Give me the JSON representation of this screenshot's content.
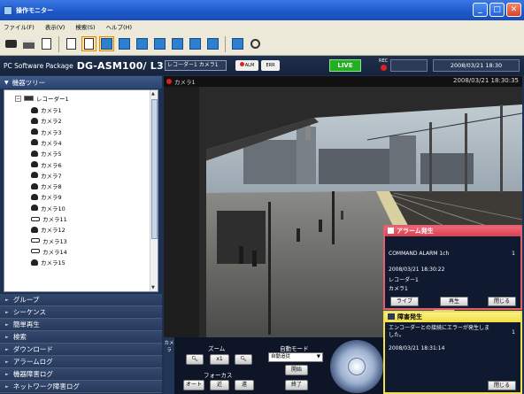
{
  "window": {
    "title": "操作モニター",
    "min": "_",
    "max": "□",
    "close": "✕"
  },
  "menu": [
    "ファイル(F)",
    "表示(V)",
    "検索(S)",
    "ヘルプ(H)"
  ],
  "header": {
    "pkg_label": "PC Software Package",
    "model": "DG-ASM100/ L3",
    "rec_cam": "レコーダー1 カメラ1",
    "alm_label": "ALM",
    "err_label": "ERR",
    "live": "LIVE",
    "rec_label": "REC",
    "datetime": "2008/03/21 18:30"
  },
  "tree": {
    "title": "機器ツリー",
    "recorder": "レコーダー1",
    "cameras": [
      "カメラ1",
      "カメラ2",
      "カメラ3",
      "カメラ4",
      "カメラ5",
      "カメラ6",
      "カメラ7",
      "カメラ8",
      "カメラ9",
      "カメラ10",
      "カメラ11",
      "カメラ12",
      "カメラ13",
      "カメラ14",
      "カメラ15"
    ]
  },
  "nav": [
    "グループ",
    "シーケンス",
    "簡単再生",
    "検索",
    "ダウンロード",
    "アラームログ",
    "機器障害ログ",
    "ネットワーク障害ログ"
  ],
  "video": {
    "camera": "カメラ1",
    "timestamp": "2008/03/21 18:30:35"
  },
  "controls": {
    "side_tab": "カメラ",
    "zoom_title": "ズーム",
    "zoom_x1": "x1",
    "focus_title": "フォーカス",
    "focus_auto": "オート",
    "focus_near": "近",
    "focus_far": "遠",
    "auto_title": "自動モード",
    "auto_value": "自動追従",
    "start": "開始",
    "stop": "終了"
  },
  "alarm": {
    "title": "アラーム発生",
    "message": "COMMAND ALARM 1ch",
    "count": "1",
    "datetime": "2008/03/21 18:30:22",
    "recorder": "レコーダー1",
    "camera": "カメラ1",
    "live_btn": "ライブ",
    "play_btn": "再生",
    "close_btn": "閉じる"
  },
  "fault": {
    "title": "障害発生",
    "message": "エンコーダーとの接続にエラーが発生しました。",
    "count": "1",
    "datetime": "2008/03/21 18:31:14",
    "close_btn": "閉じる"
  }
}
